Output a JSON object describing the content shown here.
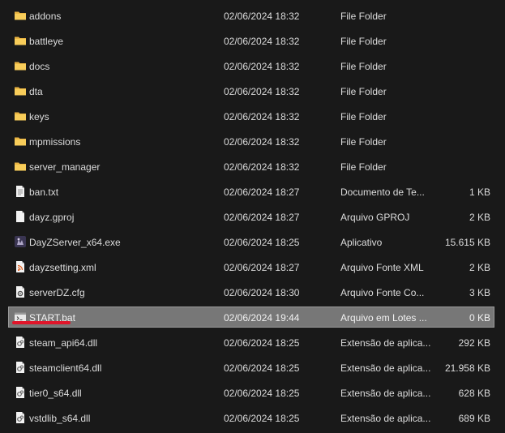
{
  "accent_color": "#e0152a",
  "files": [
    {
      "name": "addons",
      "modified": "02/06/2024 18:32",
      "type": "File Folder",
      "size": "",
      "icon": "folder-icon"
    },
    {
      "name": "battleye",
      "modified": "02/06/2024 18:32",
      "type": "File Folder",
      "size": "",
      "icon": "folder-icon"
    },
    {
      "name": "docs",
      "modified": "02/06/2024 18:32",
      "type": "File Folder",
      "size": "",
      "icon": "folder-icon"
    },
    {
      "name": "dta",
      "modified": "02/06/2024 18:32",
      "type": "File Folder",
      "size": "",
      "icon": "folder-icon"
    },
    {
      "name": "keys",
      "modified": "02/06/2024 18:32",
      "type": "File Folder",
      "size": "",
      "icon": "folder-icon"
    },
    {
      "name": "mpmissions",
      "modified": "02/06/2024 18:32",
      "type": "File Folder",
      "size": "",
      "icon": "folder-icon"
    },
    {
      "name": "server_manager",
      "modified": "02/06/2024 18:32",
      "type": "File Folder",
      "size": "",
      "icon": "folder-icon"
    },
    {
      "name": "ban.txt",
      "modified": "02/06/2024 18:27",
      "type": "Documento de Te...",
      "size": "1 KB",
      "icon": "text-file-icon"
    },
    {
      "name": "dayz.gproj",
      "modified": "02/06/2024 18:27",
      "type": "Arquivo GPROJ",
      "size": "2 KB",
      "icon": "generic-file-icon"
    },
    {
      "name": "DayZServer_x64.exe",
      "modified": "02/06/2024 18:25",
      "type": "Aplicativo",
      "size": "15.615 KB",
      "icon": "dayz-app-icon"
    },
    {
      "name": "dayzsetting.xml",
      "modified": "02/06/2024 18:27",
      "type": "Arquivo Fonte XML",
      "size": "2 KB",
      "icon": "xml-file-icon"
    },
    {
      "name": "serverDZ.cfg",
      "modified": "02/06/2024 18:30",
      "type": "Arquivo Fonte Co...",
      "size": "3 KB",
      "icon": "config-file-icon"
    },
    {
      "name": "START.bat",
      "modified": "02/06/2024 19:44",
      "type": "Arquivo em Lotes ...",
      "size": "0 KB",
      "icon": "batch-file-icon",
      "selected": true
    },
    {
      "name": "steam_api64.dll",
      "modified": "02/06/2024 18:25",
      "type": "Extensão de aplica...",
      "size": "292 KB",
      "icon": "dll-file-icon"
    },
    {
      "name": "steamclient64.dll",
      "modified": "02/06/2024 18:25",
      "type": "Extensão de aplica...",
      "size": "21.958 KB",
      "icon": "dll-file-icon"
    },
    {
      "name": "tier0_s64.dll",
      "modified": "02/06/2024 18:25",
      "type": "Extensão de aplica...",
      "size": "628 KB",
      "icon": "dll-file-icon"
    },
    {
      "name": "vstdlib_s64.dll",
      "modified": "02/06/2024 18:25",
      "type": "Extensão de aplica...",
      "size": "689 KB",
      "icon": "dll-file-icon"
    }
  ]
}
